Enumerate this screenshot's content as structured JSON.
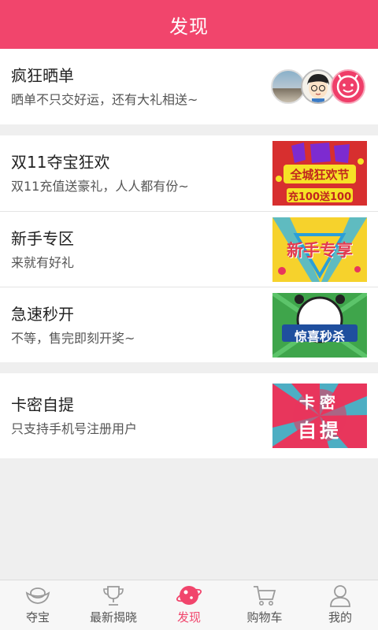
{
  "header": {
    "title": "发现"
  },
  "sections": {
    "share": {
      "title": "疯狂晒单",
      "subtitle": "晒单不只交好运，还有大礼相送~"
    },
    "carnival": {
      "title": "双11夺宝狂欢",
      "subtitle": "双11充值送豪礼，人人都有份~",
      "banner_line1": "全城狂欢节",
      "banner_line2": "充100送100"
    },
    "newbie": {
      "title": "新手专区",
      "subtitle": "来就有好礼",
      "banner": "新手专享"
    },
    "flash": {
      "title": "急速秒开",
      "subtitle": "不等，售完即刻开奖~",
      "banner": "惊喜秒杀"
    },
    "card": {
      "title": "卡密自提",
      "subtitle": "只支持手机号注册用户",
      "banner_line1": "卡密",
      "banner_line2": "自提"
    }
  },
  "tabbar": {
    "items": [
      {
        "label": "夺宝",
        "icon": "ingot-icon"
      },
      {
        "label": "最新揭晓",
        "icon": "trophy-icon"
      },
      {
        "label": "发现",
        "icon": "planet-icon",
        "active": true
      },
      {
        "label": "购物车",
        "icon": "cart-icon"
      },
      {
        "label": "我的",
        "icon": "user-icon"
      }
    ]
  },
  "colors": {
    "accent": "#f1456c",
    "background": "#efefef"
  }
}
